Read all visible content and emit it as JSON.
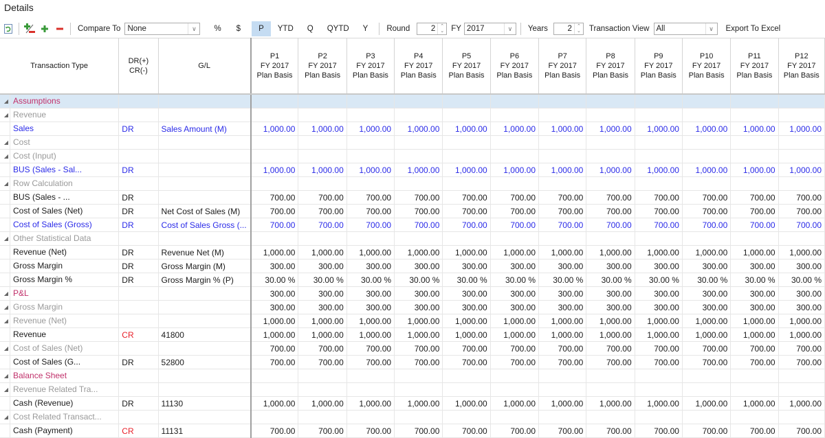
{
  "title": "Details",
  "toolbar": {
    "compare_to_label": "Compare To",
    "compare_to_value": "None",
    "percent_label": "%",
    "dollar_label": "$",
    "periods": [
      "P",
      "YTD",
      "Q",
      "QYTD",
      "Y"
    ],
    "active_period": "P",
    "round_label": "Round",
    "round_value": "2",
    "fy_label": "FY",
    "fy_value": "2017",
    "years_label": "Years",
    "years_value": "2",
    "transaction_view_label": "Transaction View",
    "transaction_view_value": "All",
    "export_label": "Export To Excel",
    "icons": [
      "refresh-icon",
      "add-remove-icon",
      "add-icon",
      "remove-icon"
    ]
  },
  "colors": {
    "root": "#c0306a",
    "group": "#999999",
    "input_blue": "#2a2ae8",
    "credit_red": "#e8202a",
    "selected_row": "#d9e8f5",
    "active_button": "#c5dcf2"
  },
  "columns": {
    "transaction_type": "Transaction Type",
    "drcr": [
      "DR(+)",
      "CR(-)"
    ],
    "gl": "G/L",
    "periods": [
      {
        "p": "P1",
        "fy": "FY 2017",
        "basis": "Plan Basis"
      },
      {
        "p": "P2",
        "fy": "FY 2017",
        "basis": "Plan Basis"
      },
      {
        "p": "P3",
        "fy": "FY 2017",
        "basis": "Plan Basis"
      },
      {
        "p": "P4",
        "fy": "FY 2017",
        "basis": "Plan Basis"
      },
      {
        "p": "P5",
        "fy": "FY 2017",
        "basis": "Plan Basis"
      },
      {
        "p": "P6",
        "fy": "FY 2017",
        "basis": "Plan Basis"
      },
      {
        "p": "P7",
        "fy": "FY 2017",
        "basis": "Plan Basis"
      },
      {
        "p": "P8",
        "fy": "FY 2017",
        "basis": "Plan Basis"
      },
      {
        "p": "P9",
        "fy": "FY 2017",
        "basis": "Plan Basis"
      },
      {
        "p": "P10",
        "fy": "FY 2017",
        "basis": "Plan Basis"
      },
      {
        "p": "P11",
        "fy": "FY 2017",
        "basis": "Plan Basis"
      },
      {
        "p": "P12",
        "fy": "FY 2017",
        "basis": "Plan Basis"
      }
    ]
  },
  "rows": [
    {
      "label": "Assumptions",
      "level": 0,
      "expander": true,
      "style": "root",
      "drcr": "",
      "drcr_style": "",
      "gl": "",
      "gl_style": "",
      "values": [],
      "val_style": "",
      "selected": true
    },
    {
      "label": "Revenue",
      "level": 1,
      "expander": true,
      "style": "grp",
      "drcr": "",
      "gl": "",
      "values": []
    },
    {
      "label": "Sales",
      "level": 2,
      "expander": false,
      "style": "blue",
      "drcr": "DR",
      "drcr_style": "blue",
      "gl": "Sales Amount (M)",
      "gl_style": "blue",
      "values": [
        "1,000.00",
        "1,000.00",
        "1,000.00",
        "1,000.00",
        "1,000.00",
        "1,000.00",
        "1,000.00",
        "1,000.00",
        "1,000.00",
        "1,000.00",
        "1,000.00",
        "1,000.00"
      ],
      "val_style": "blue"
    },
    {
      "label": "Cost",
      "level": 1,
      "expander": true,
      "style": "grp",
      "drcr": "",
      "gl": "",
      "values": []
    },
    {
      "label": "Cost (Input)",
      "level": 2,
      "expander": true,
      "style": "grp",
      "drcr": "",
      "gl": "",
      "values": []
    },
    {
      "label": "BUS (Sales - Sal...",
      "level": 3,
      "expander": false,
      "style": "blue",
      "drcr": "DR",
      "drcr_style": "blue",
      "gl": "",
      "values": [
        "1,000.00",
        "1,000.00",
        "1,000.00",
        "1,000.00",
        "1,000.00",
        "1,000.00",
        "1,000.00",
        "1,000.00",
        "1,000.00",
        "1,000.00",
        "1,000.00",
        "1,000.00"
      ],
      "val_style": "blue"
    },
    {
      "label": "Row Calculation",
      "level": 3,
      "expander": true,
      "style": "grp",
      "drcr": "",
      "gl": "",
      "values": []
    },
    {
      "label": "BUS (Sales - ...",
      "level": 4,
      "expander": false,
      "style": "black",
      "drcr": "DR",
      "drcr_style": "black",
      "gl": "",
      "values": [
        "700.00",
        "700.00",
        "700.00",
        "700.00",
        "700.00",
        "700.00",
        "700.00",
        "700.00",
        "700.00",
        "700.00",
        "700.00",
        "700.00"
      ],
      "val_style": "black"
    },
    {
      "label": "Cost of Sales (Net)",
      "level": 2,
      "expander": false,
      "style": "black",
      "drcr": "DR",
      "drcr_style": "black",
      "gl": "Net Cost of Sales (M)",
      "gl_style": "black",
      "values": [
        "700.00",
        "700.00",
        "700.00",
        "700.00",
        "700.00",
        "700.00",
        "700.00",
        "700.00",
        "700.00",
        "700.00",
        "700.00",
        "700.00"
      ],
      "val_style": "black"
    },
    {
      "label": "Cost of Sales (Gross)",
      "level": 2,
      "expander": false,
      "style": "blue",
      "drcr": "DR",
      "drcr_style": "blue",
      "gl": "Cost of Sales Gross (...",
      "gl_style": "blue",
      "values": [
        "700.00",
        "700.00",
        "700.00",
        "700.00",
        "700.00",
        "700.00",
        "700.00",
        "700.00",
        "700.00",
        "700.00",
        "700.00",
        "700.00"
      ],
      "val_style": "blue"
    },
    {
      "label": "Other Statistical Data",
      "level": 1,
      "expander": true,
      "style": "grp",
      "drcr": "",
      "gl": "",
      "values": []
    },
    {
      "label": "Revenue (Net)",
      "level": 2,
      "expander": false,
      "style": "black",
      "drcr": "DR",
      "drcr_style": "black",
      "gl": "Revenue Net (M)",
      "gl_style": "black",
      "values": [
        "1,000.00",
        "1,000.00",
        "1,000.00",
        "1,000.00",
        "1,000.00",
        "1,000.00",
        "1,000.00",
        "1,000.00",
        "1,000.00",
        "1,000.00",
        "1,000.00",
        "1,000.00"
      ],
      "val_style": "black"
    },
    {
      "label": "Gross Margin",
      "level": 2,
      "expander": false,
      "style": "black",
      "drcr": "DR",
      "drcr_style": "black",
      "gl": "Gross Margin (M)",
      "gl_style": "black",
      "values": [
        "300.00",
        "300.00",
        "300.00",
        "300.00",
        "300.00",
        "300.00",
        "300.00",
        "300.00",
        "300.00",
        "300.00",
        "300.00",
        "300.00"
      ],
      "val_style": "black"
    },
    {
      "label": "Gross Margin %",
      "level": 2,
      "expander": false,
      "style": "black",
      "drcr": "DR",
      "drcr_style": "black",
      "gl": "Gross Margin % (P)",
      "gl_style": "black",
      "values": [
        "30.00 %",
        "30.00 %",
        "30.00 %",
        "30.00 %",
        "30.00 %",
        "30.00 %",
        "30.00 %",
        "30.00 %",
        "30.00 %",
        "30.00 %",
        "30.00 %",
        "30.00 %"
      ],
      "val_style": "black"
    },
    {
      "label": "P&L",
      "level": 0,
      "expander": true,
      "style": "root",
      "drcr": "",
      "gl": "",
      "values": [
        "300.00",
        "300.00",
        "300.00",
        "300.00",
        "300.00",
        "300.00",
        "300.00",
        "300.00",
        "300.00",
        "300.00",
        "300.00",
        "300.00"
      ],
      "val_style": "black"
    },
    {
      "label": "Gross Margin",
      "level": 1,
      "expander": true,
      "style": "grp",
      "drcr": "",
      "gl": "",
      "values": [
        "300.00",
        "300.00",
        "300.00",
        "300.00",
        "300.00",
        "300.00",
        "300.00",
        "300.00",
        "300.00",
        "300.00",
        "300.00",
        "300.00"
      ],
      "val_style": "black"
    },
    {
      "label": "Revenue (Net)",
      "level": 2,
      "expander": true,
      "style": "grp",
      "drcr": "",
      "gl": "",
      "values": [
        "1,000.00",
        "1,000.00",
        "1,000.00",
        "1,000.00",
        "1,000.00",
        "1,000.00",
        "1,000.00",
        "1,000.00",
        "1,000.00",
        "1,000.00",
        "1,000.00",
        "1,000.00"
      ],
      "val_style": "black"
    },
    {
      "label": "Revenue",
      "level": 3,
      "expander": false,
      "style": "black",
      "drcr": "CR",
      "drcr_style": "red",
      "gl": "41800",
      "gl_style": "black",
      "values": [
        "1,000.00",
        "1,000.00",
        "1,000.00",
        "1,000.00",
        "1,000.00",
        "1,000.00",
        "1,000.00",
        "1,000.00",
        "1,000.00",
        "1,000.00",
        "1,000.00",
        "1,000.00"
      ],
      "val_style": "black"
    },
    {
      "label": "Cost of Sales (Net)",
      "level": 2,
      "expander": true,
      "style": "grp",
      "drcr": "",
      "gl": "",
      "values": [
        "700.00",
        "700.00",
        "700.00",
        "700.00",
        "700.00",
        "700.00",
        "700.00",
        "700.00",
        "700.00",
        "700.00",
        "700.00",
        "700.00"
      ],
      "val_style": "black"
    },
    {
      "label": "Cost of Sales (G...",
      "level": 3,
      "expander": false,
      "style": "black",
      "drcr": "DR",
      "drcr_style": "black",
      "gl": "52800",
      "gl_style": "black",
      "values": [
        "700.00",
        "700.00",
        "700.00",
        "700.00",
        "700.00",
        "700.00",
        "700.00",
        "700.00",
        "700.00",
        "700.00",
        "700.00",
        "700.00"
      ],
      "val_style": "black"
    },
    {
      "label": "Balance Sheet",
      "level": 0,
      "expander": true,
      "style": "root",
      "drcr": "",
      "gl": "",
      "values": []
    },
    {
      "label": "Revenue Related Tra...",
      "level": 1,
      "expander": true,
      "style": "grp",
      "drcr": "",
      "gl": "",
      "values": []
    },
    {
      "label": "Cash (Revenue)",
      "level": 2,
      "expander": false,
      "style": "black",
      "drcr": "DR",
      "drcr_style": "black",
      "gl": "11130",
      "gl_style": "black",
      "values": [
        "1,000.00",
        "1,000.00",
        "1,000.00",
        "1,000.00",
        "1,000.00",
        "1,000.00",
        "1,000.00",
        "1,000.00",
        "1,000.00",
        "1,000.00",
        "1,000.00",
        "1,000.00"
      ],
      "val_style": "black"
    },
    {
      "label": "Cost Related Transact...",
      "level": 1,
      "expander": true,
      "style": "grp",
      "drcr": "",
      "gl": "",
      "values": []
    },
    {
      "label": "Cash (Payment)",
      "level": 2,
      "expander": false,
      "style": "black",
      "drcr": "CR",
      "drcr_style": "red",
      "gl": "11131",
      "gl_style": "black",
      "values": [
        "700.00",
        "700.00",
        "700.00",
        "700.00",
        "700.00",
        "700.00",
        "700.00",
        "700.00",
        "700.00",
        "700.00",
        "700.00",
        "700.00"
      ],
      "val_style": "black"
    }
  ]
}
